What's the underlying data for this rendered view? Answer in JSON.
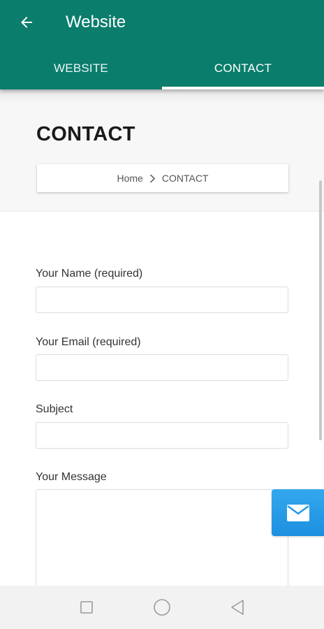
{
  "app_bar": {
    "title": "Website",
    "tabs": [
      {
        "label": "WEBSITE",
        "active": false
      },
      {
        "label": "CONTACT",
        "active": true
      }
    ],
    "color": "#0b7d6c"
  },
  "page": {
    "title": "CONTACT",
    "breadcrumb": {
      "home": "Home",
      "current": "CONTACT"
    }
  },
  "form": {
    "name_label": "Your Name (required)",
    "name_value": "",
    "email_label": "Your Email (required)",
    "email_value": "",
    "subject_label": "Subject",
    "subject_value": "",
    "message_label": "Your Message",
    "message_value": ""
  },
  "icons": {
    "back": "arrow-left-icon",
    "breadcrumb_separator": "chevron-right-icon",
    "mail": "envelope-icon",
    "nav_recents": "square-icon",
    "nav_home": "circle-icon",
    "nav_back": "triangle-left-icon"
  },
  "colors": {
    "mail_button": "#2196e8"
  }
}
